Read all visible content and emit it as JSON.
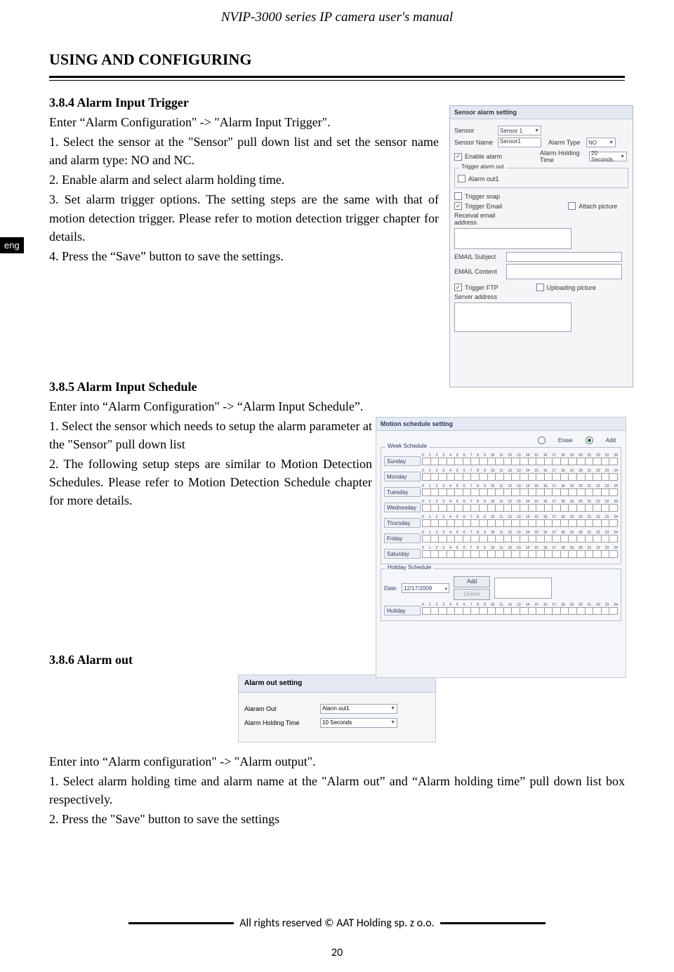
{
  "header": {
    "title": "NVIP-3000 series IP camera user's manual"
  },
  "lang_tab": "eng",
  "section_heading": "USING AND CONFIGURING",
  "s384": {
    "title": "3.8.4 Alarm Input Trigger",
    "p0": "Enter “Alarm Configuration\" -> \"Alarm Input Trigger\".",
    "p1": "1. Select the sensor at the \"Sensor\" pull down list and set the sensor name and alarm type: NO and NC.",
    "p2": "2. Enable alarm and select alarm holding time.",
    "p3": "3. Set alarm trigger options. The setting steps are the same with that of motion detection trigger. Please refer to motion detection trigger chapter for details.",
    "p4": "4. Press the “Save” button to save the settings."
  },
  "s385": {
    "title": "3.8.5 Alarm Input Schedule",
    "p0": "Enter into “Alarm Configuration\" -> “Alarm Input Schedule”.",
    "p1": "1. Select the sensor which needs to setup the alarm parameter at the \"Sensor\" pull down list",
    "p2": "2. The following setup steps are similar to Motion Detection Schedules. Please refer to Motion Detection Schedule chapter for more details."
  },
  "s386": {
    "title": "3.8.6 Alarm out",
    "p0": "Enter into “Alarm configuration\" -> \"Alarm output\".",
    "p1": "1. Select alarm holding time and alarm name at the \"Alarm out” and “Alarm holding time” pull down list box respectively.",
    "p2": "2. Press the \"Save\" button to save the settings"
  },
  "panel1": {
    "title": "Sensor alarm setting",
    "labels": {
      "sensor": "Sensor",
      "sensor_name": "Sensor Name",
      "alarm_type": "Alarm Type",
      "alarm_holding_time": "Alarm Holding Time",
      "enable_alarm": "Enable alarm",
      "trigger_alarm_out": "Trigger alarm out",
      "alarm_out1": "Alarm out1",
      "trigger_snap": "Trigger snap",
      "trigger_email": "Trigger Email",
      "attach_picture": "Attach picture",
      "receival_email": "Receival email address",
      "email_subject": "EMAIL Subject",
      "email_content": "EMAIL Content",
      "trigger_ftp": "Trigger FTP",
      "uploading_picture": "Uploading picture",
      "server_address": "Server address"
    },
    "values": {
      "sensor": "Sensor 1",
      "sensor_name": "Sensor1",
      "alarm_type": "NO",
      "alarm_holding_time": "20 Seconds",
      "enable_alarm_checked": "✓",
      "alarm_out1_checked": "",
      "trigger_snap_checked": "",
      "trigger_email_checked": "✓",
      "attach_picture_checked": "",
      "trigger_ftp_checked": "✓",
      "uploading_picture_checked": ""
    }
  },
  "panel2": {
    "title": "Motion schedule setting",
    "erase": "Erase",
    "add": "Add",
    "week_schedule": "Week Schedule",
    "holiday_schedule": "Holiday Schedule",
    "days": [
      "Sunday",
      "Monday",
      "Tuesday",
      "Wednesday",
      "Thursday",
      "Friday",
      "Saturday"
    ],
    "ticks": [
      "0",
      "1",
      "2",
      "3",
      "4",
      "5",
      "6",
      "7",
      "8",
      "9",
      "10",
      "11",
      "12",
      "13",
      "14",
      "15",
      "16",
      "17",
      "18",
      "19",
      "20",
      "21",
      "22",
      "23",
      "24"
    ],
    "date_label": "Date:",
    "date_value": "12/17/2009",
    "add_btn": "Add",
    "delete_btn": "Delete",
    "holiday": "Holiday"
  },
  "panel3": {
    "title": "Alarm out setting",
    "alarm_out_label": "Alaram Out",
    "alarm_out_value": "Alarm out1",
    "holding_label": "Alarm Holding Time",
    "holding_value": "10 Seconds"
  },
  "footer": "All rights reserved © AAT Holding sp. z o.o.",
  "page_number": "20"
}
